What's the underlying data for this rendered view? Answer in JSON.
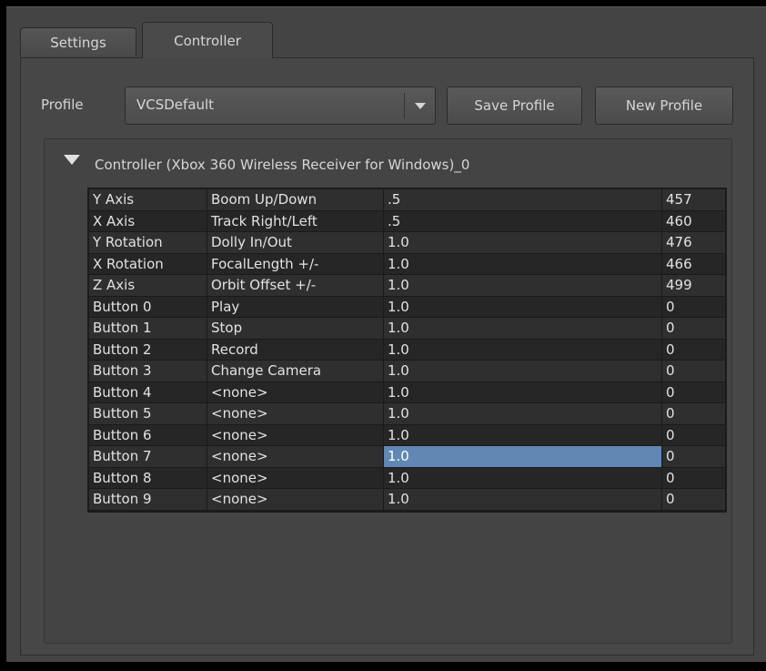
{
  "tabs": [
    {
      "label": "Settings",
      "active": false
    },
    {
      "label": "Controller",
      "active": true
    }
  ],
  "profile": {
    "label": "Profile",
    "selected": "VCSDefault",
    "save_label": "Save Profile",
    "new_label": "New Profile"
  },
  "group": {
    "title": "Controller (Xbox 360 Wireless Receiver for Windows)_0",
    "expanded": true
  },
  "mappings": [
    [
      "Y Axis",
      "Boom Up/Down",
      ".5",
      "457"
    ],
    [
      "X Axis",
      "Track Right/Left",
      ".5",
      "460"
    ],
    [
      "Y Rotation",
      "Dolly In/Out",
      "1.0",
      "476"
    ],
    [
      "X Rotation",
      "FocalLength +/-",
      "1.0",
      "466"
    ],
    [
      "Z Axis",
      "Orbit Offset +/-",
      "1.0",
      "499"
    ],
    [
      "Button 0",
      "Play",
      "1.0",
      "0"
    ],
    [
      "Button 1",
      "Stop",
      "1.0",
      "0"
    ],
    [
      "Button 2",
      "Record",
      "1.0",
      "0"
    ],
    [
      "Button 3",
      "Change Camera",
      "1.0",
      "0"
    ],
    [
      "Button 4",
      "<none>",
      "1.0",
      "0"
    ],
    [
      "Button 5",
      "<none>",
      "1.0",
      "0"
    ],
    [
      "Button 6",
      "<none>",
      "1.0",
      "0"
    ],
    [
      "Button 7",
      "<none>",
      "1.0",
      "0"
    ],
    [
      "Button 8",
      "<none>",
      "1.0",
      "0"
    ],
    [
      "Button 9",
      "<none>",
      "1.0",
      "0"
    ]
  ],
  "selected_cell": {
    "row": 12,
    "col": 2
  },
  "colors": {
    "selection": "#6088b3",
    "panel": "#444444"
  }
}
